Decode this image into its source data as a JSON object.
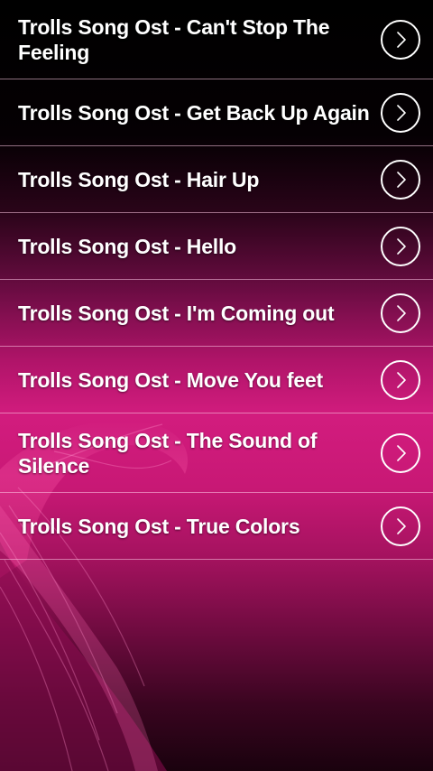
{
  "songs": [
    {
      "title": "Trolls Song Ost - Can't Stop The Feeling",
      "icon": "chevron-right-circle-icon"
    },
    {
      "title": "Trolls Song Ost - Get Back Up Again",
      "icon": "chevron-right-circle-icon"
    },
    {
      "title": "Trolls Song Ost - Hair Up",
      "icon": "chevron-right-circle-icon"
    },
    {
      "title": "Trolls Song Ost - Hello",
      "icon": "chevron-right-circle-icon"
    },
    {
      "title": "Trolls Song Ost - I'm Coming out",
      "icon": "chevron-right-circle-icon"
    },
    {
      "title": "Trolls Song Ost - Move You feet",
      "icon": "chevron-right-circle-icon"
    },
    {
      "title": "Trolls Song Ost - The Sound of Silence",
      "icon": "chevron-right-circle-icon"
    },
    {
      "title": "Trolls Song Ost - True Colors",
      "icon": "chevron-right-circle-icon"
    }
  ],
  "colors": {
    "background_accent": "#d21c7e",
    "text": "#ffffff",
    "divider": "#ffc8e6"
  }
}
